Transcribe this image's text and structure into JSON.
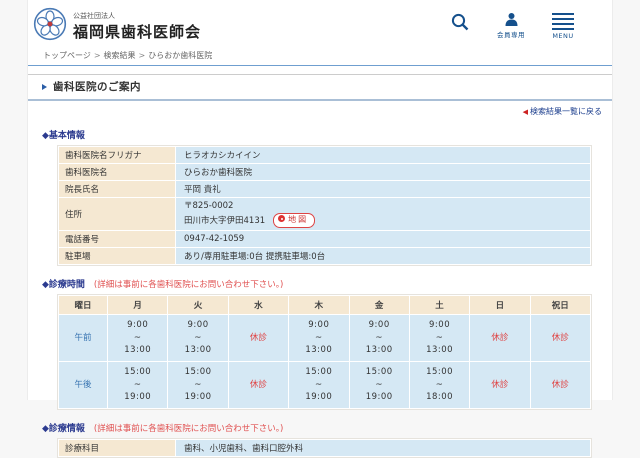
{
  "brand": {
    "org_type": "公益社団法人",
    "org_name": "福岡県歯科医師会"
  },
  "header": {
    "member_label": "会員専用",
    "menu_label": "MENU"
  },
  "breadcrumb": {
    "items": [
      "トップページ",
      "検索結果",
      "ひらおか歯科医院"
    ],
    "separator": ">"
  },
  "page": {
    "title": "歯科医院のご案内",
    "back_link": "検索結果一覧に戻る"
  },
  "basic_info": {
    "heading": "◆基本情報",
    "rows": [
      {
        "label": "歯科医院名フリガナ",
        "value": "ヒラオカシカイイン"
      },
      {
        "label": "歯科医院名",
        "value": "ひらおか歯科医院"
      },
      {
        "label": "院長氏名",
        "value": "平岡 貴礼"
      },
      {
        "label": "住所",
        "value_lines": [
          "〒825-0002",
          "田川市大字伊田4131"
        ],
        "map_button": "地図"
      },
      {
        "label": "電話番号",
        "value": "0947-42-1059"
      },
      {
        "label": "駐車場",
        "value": "あり/専用駐車場:0台 提携駐車場:0台"
      }
    ]
  },
  "hours": {
    "heading": "◆診療時間",
    "note": "(詳細は事前に各歯科医院にお問い合わせ下さい。)",
    "columns": [
      "曜日",
      "月",
      "火",
      "水",
      "木",
      "金",
      "土",
      "日",
      "祝日"
    ],
    "closed_label": "休診",
    "tilde": "~",
    "rows": [
      {
        "label": "午前",
        "cells": [
          [
            "9:00",
            "13:00"
          ],
          [
            "9:00",
            "13:00"
          ],
          null,
          [
            "9:00",
            "13:00"
          ],
          [
            "9:00",
            "13:00"
          ],
          [
            "9:00",
            "13:00"
          ],
          null,
          null
        ]
      },
      {
        "label": "午後",
        "cells": [
          [
            "15:00",
            "19:00"
          ],
          [
            "15:00",
            "19:00"
          ],
          null,
          [
            "15:00",
            "19:00"
          ],
          [
            "15:00",
            "19:00"
          ],
          [
            "15:00",
            "18:00"
          ],
          null,
          null
        ]
      }
    ]
  },
  "treatment": {
    "heading": "◆診療情報",
    "note": "(詳細は事前に各歯科医院にお問い合わせ下さい。)",
    "rows": [
      {
        "label": "診療科目",
        "value": "歯科、小児歯科、歯科口腔外科"
      }
    ]
  },
  "colors": {
    "brand_blue": "#15508c",
    "heading_navy": "#2b3a8f",
    "note_red": "#e05050",
    "closed_red": "#e04040",
    "label_cell": "#f5e8d2",
    "value_cell": "#d5e8f4"
  }
}
